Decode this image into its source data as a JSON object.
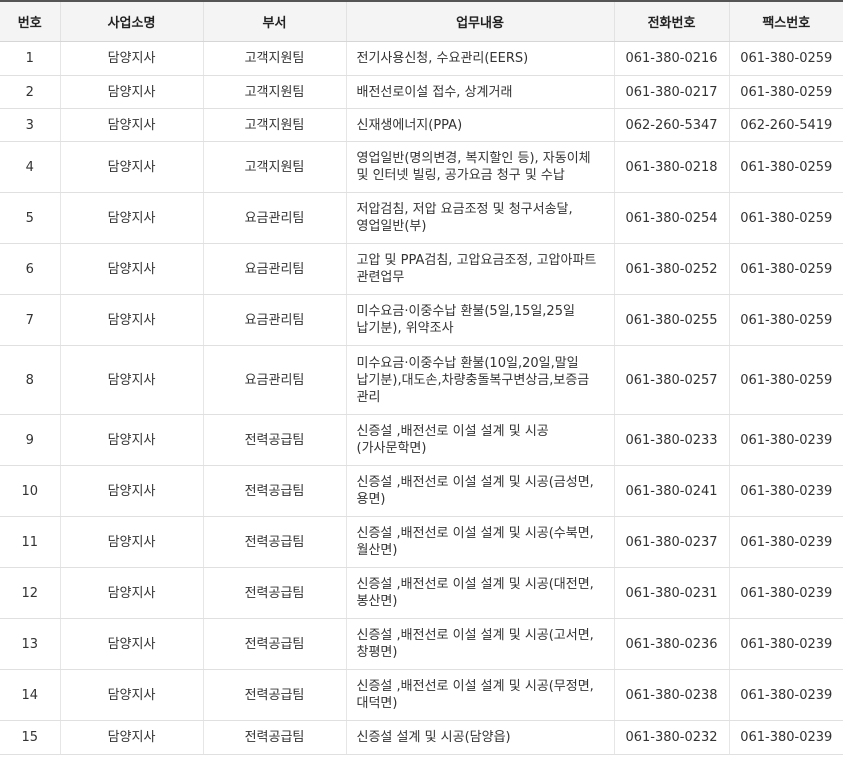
{
  "table": {
    "headers": [
      "번호",
      "사업소명",
      "부서",
      "업무내용",
      "전화번호",
      "팩스번호"
    ],
    "rows": [
      {
        "no": "1",
        "office": "담양지사",
        "dept": "고객지원팀",
        "duty": "전기사용신청, 수요관리(EERS)",
        "phone": "061-380-0216",
        "fax": "061-380-0259"
      },
      {
        "no": "2",
        "office": "담양지사",
        "dept": "고객지원팀",
        "duty": "배전선로이설 접수, 상계거래",
        "phone": "061-380-0217",
        "fax": "061-380-0259"
      },
      {
        "no": "3",
        "office": "담양지사",
        "dept": "고객지원팀",
        "duty": "신재생에너지(PPA)",
        "phone": "062-260-5347",
        "fax": "062-260-5419"
      },
      {
        "no": "4",
        "office": "담양지사",
        "dept": "고객지원팀",
        "duty": "영업일반(명의변경, 복지할인 등), 자동이체 및 인터넷 빌링, 공가요금 청구 및 수납",
        "phone": "061-380-0218",
        "fax": "061-380-0259"
      },
      {
        "no": "5",
        "office": "담양지사",
        "dept": "요금관리팀",
        "duty": "저압검침, 저압 요금조정 및 청구서송달, 영업일반(부)",
        "phone": "061-380-0254",
        "fax": "061-380-0259"
      },
      {
        "no": "6",
        "office": "담양지사",
        "dept": "요금관리팀",
        "duty": "고압 및 PPA검침, 고압요금조정, 고압아파트 관련업무",
        "phone": "061-380-0252",
        "fax": "061-380-0259"
      },
      {
        "no": "7",
        "office": "담양지사",
        "dept": "요금관리팀",
        "duty": "미수요금·이중수납 환불(5일,15일,25일 납기분), 위약조사",
        "phone": "061-380-0255",
        "fax": "061-380-0259"
      },
      {
        "no": "8",
        "office": "담양지사",
        "dept": "요금관리팀",
        "duty": "미수요금·이중수납 환불(10일,20일,말일 납기분),대도손,차량충돌복구변상금,보증금 관리",
        "phone": "061-380-0257",
        "fax": "061-380-0259"
      },
      {
        "no": "9",
        "office": "담양지사",
        "dept": "전력공급팀",
        "duty": "신증설 ,배전선로 이설 설계 및 시공(가사문학면)",
        "phone": "061-380-0233",
        "fax": "061-380-0239"
      },
      {
        "no": "10",
        "office": "담양지사",
        "dept": "전력공급팀",
        "duty": "신증설 ,배전선로 이설 설계 및 시공(금성면,용면)",
        "phone": "061-380-0241",
        "fax": "061-380-0239"
      },
      {
        "no": "11",
        "office": "담양지사",
        "dept": "전력공급팀",
        "duty": "신증설 ,배전선로 이설 설계 및 시공(수북면,월산면)",
        "phone": "061-380-0237",
        "fax": "061-380-0239"
      },
      {
        "no": "12",
        "office": "담양지사",
        "dept": "전력공급팀",
        "duty": "신증설 ,배전선로 이설 설계 및 시공(대전면,봉산면)",
        "phone": "061-380-0231",
        "fax": "061-380-0239"
      },
      {
        "no": "13",
        "office": "담양지사",
        "dept": "전력공급팀",
        "duty": "신증설 ,배전선로 이설 설계 및 시공(고서면,창평면)",
        "phone": "061-380-0236",
        "fax": "061-380-0239"
      },
      {
        "no": "14",
        "office": "담양지사",
        "dept": "전력공급팀",
        "duty": "신증설 ,배전선로 이설 설계 및 시공(무정면,대덕면)",
        "phone": "061-380-0238",
        "fax": "061-380-0239"
      },
      {
        "no": "15",
        "office": "담양지사",
        "dept": "전력공급팀",
        "duty": "신증설 설계 및 시공(담양읍)",
        "phone": "061-380-0232",
        "fax": "061-380-0239"
      }
    ]
  }
}
